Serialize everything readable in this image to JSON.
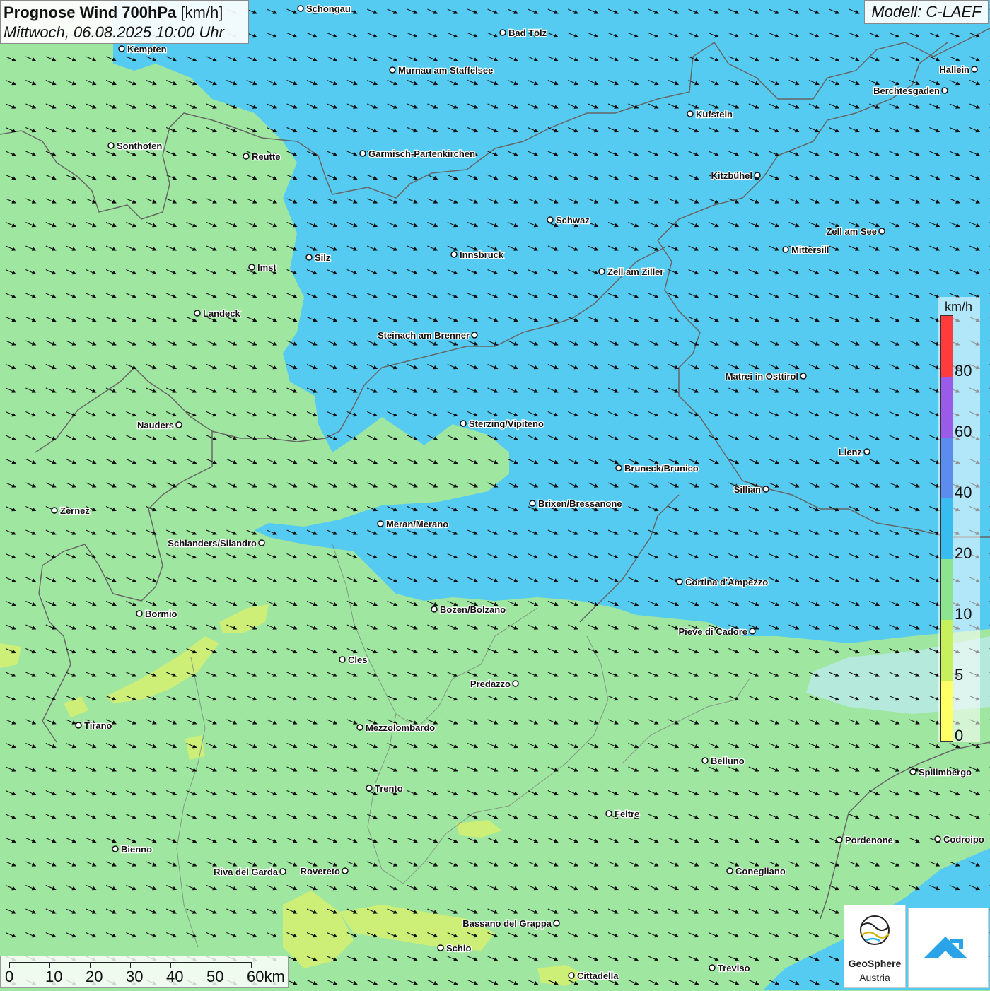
{
  "title": {
    "main": "Prognose Wind 700hPa",
    "unit": "[km/h]",
    "datetime": "Mittwoch, 06.08.2025 10:00 Uhr"
  },
  "model": "Modell: C-LAEF",
  "legend": {
    "unit": "km/h",
    "labels": [
      "80",
      "60",
      "40",
      "20",
      "10",
      "5",
      "0"
    ],
    "colors": [
      "#ff3b3b",
      "#9a5ce8",
      "#5b8cee",
      "#39bdf0",
      "#8ce58e",
      "#c6f15c",
      "#ffff66"
    ]
  },
  "scale": {
    "labels": [
      "0",
      "10",
      "20",
      "30",
      "40",
      "50",
      "60km"
    ]
  },
  "logos": {
    "geosphere": "GeoSphere",
    "austria": "Austria"
  },
  "colors": {
    "wind_10_20": "#9fe6a0",
    "wind_20_40": "#55cbf2",
    "wind_5_10": "#d2ef72"
  },
  "cities": [
    {
      "name": "Schongau"
    },
    {
      "name": "Bad Tölz"
    },
    {
      "name": "Kempten"
    },
    {
      "name": "Murnau am Staffelsee"
    },
    {
      "name": "Hallein"
    },
    {
      "name": "Berchtesgaden"
    },
    {
      "name": "Kufstein"
    },
    {
      "name": "Sonthofen"
    },
    {
      "name": "Reutte"
    },
    {
      "name": "Garmisch-Partenkirchen"
    },
    {
      "name": "Kitzbühel"
    },
    {
      "name": "Schwaz"
    },
    {
      "name": "Zell am See"
    },
    {
      "name": "Mittersill"
    },
    {
      "name": "Silz"
    },
    {
      "name": "Innsbruck"
    },
    {
      "name": "Imst"
    },
    {
      "name": "Zell am Ziller"
    },
    {
      "name": "Landeck"
    },
    {
      "name": "Steinach am Brenner"
    },
    {
      "name": "Matrei in Osttirol"
    },
    {
      "name": "Nauders"
    },
    {
      "name": "Sterzing/Vipiteno"
    },
    {
      "name": "Lienz"
    },
    {
      "name": "Bruneck/Brunico"
    },
    {
      "name": "Sillian"
    },
    {
      "name": "Brixen/Bressanone"
    },
    {
      "name": "Zernez"
    },
    {
      "name": "Meran/Merano"
    },
    {
      "name": "Schlanders/Silandro"
    },
    {
      "name": "Cortina d'Ampezzo"
    },
    {
      "name": "Bozen/Bolzano"
    },
    {
      "name": "Bormio"
    },
    {
      "name": "Pieve di Cadore"
    },
    {
      "name": "Cles"
    },
    {
      "name": "Predazzo"
    },
    {
      "name": "Tirano"
    },
    {
      "name": "Mezzolombardo"
    },
    {
      "name": "Belluno"
    },
    {
      "name": "Spilimbergo"
    },
    {
      "name": "Trento"
    },
    {
      "name": "Feltre"
    },
    {
      "name": "Pordenone"
    },
    {
      "name": "Codroipo"
    },
    {
      "name": "Bienno"
    },
    {
      "name": "Riva del Garda"
    },
    {
      "name": "Rovereto"
    },
    {
      "name": "Conegliano"
    },
    {
      "name": "Bassano del Grappa"
    },
    {
      "name": "Schio"
    },
    {
      "name": "Treviso"
    },
    {
      "name": "Cittadella"
    }
  ]
}
